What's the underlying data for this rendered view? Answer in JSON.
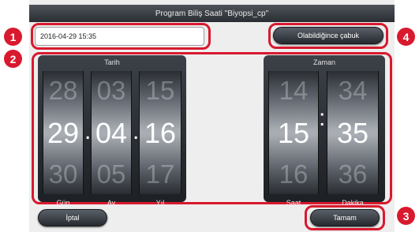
{
  "window": {
    "title": "Program Biliş Saati \"Biyopsi_cp\""
  },
  "datetime_field": {
    "value": "2016-04-29 15:35"
  },
  "buttons": {
    "asap": "Olabildiğince çabuk",
    "cancel": "İptal",
    "done": "Tamam"
  },
  "date_picker": {
    "title": "Tarih",
    "columns": [
      {
        "label": "Gün",
        "prev": "28",
        "value": "29",
        "next": "30"
      },
      {
        "label": "Ay",
        "prev": "03",
        "value": "04",
        "next": "05"
      },
      {
        "label": "Yıl",
        "prev": "15",
        "value": "16",
        "next": "17"
      }
    ],
    "separator": "."
  },
  "time_picker": {
    "title": "Zaman",
    "columns": [
      {
        "label": "Saat",
        "prev": "14",
        "value": "15",
        "next": "16"
      },
      {
        "label": "Dakika",
        "prev": "34",
        "value": "35",
        "next": "36"
      }
    ],
    "separator": ":"
  },
  "callouts": [
    "1",
    "2",
    "3",
    "4"
  ],
  "colors": {
    "accent_red": "#d8192e",
    "titlebar": "#3a3f45",
    "button": "#3d4248"
  }
}
